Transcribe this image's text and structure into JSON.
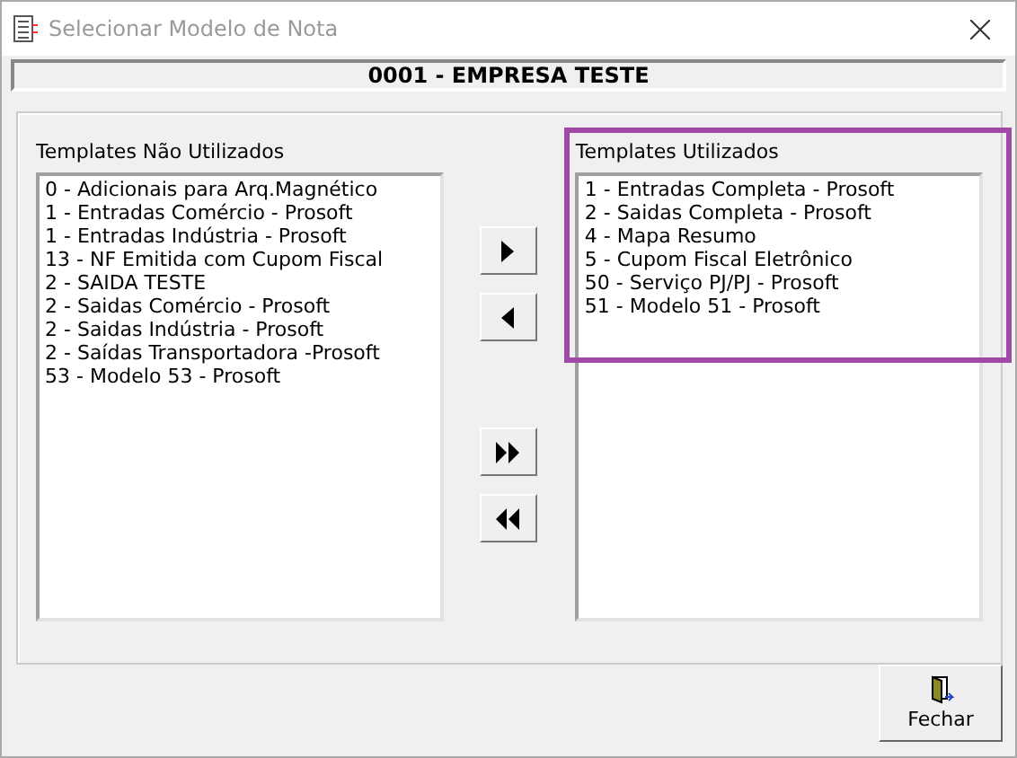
{
  "window": {
    "title": "Selecionar Modelo de Nota"
  },
  "company": "0001 - EMPRESA TESTE",
  "unused": {
    "label": "Templates Não Utilizados",
    "items": [
      {
        "text": "0 - Adicionais para Arq.Magnético"
      },
      {
        "text": "1 - Entradas Comércio - Prosoft"
      },
      {
        "text": "1 - Entradas Indústria - Prosoft"
      },
      {
        "text": "13 - NF Emitida com Cupom Fiscal"
      },
      {
        "text": "2 - SAIDA TESTE"
      },
      {
        "text": "2 - Saidas Comércio - Prosoft"
      },
      {
        "text": "2 - Saidas Indústria - Prosoft"
      },
      {
        "text": "2 - Saídas Transportadora -Prosoft"
      },
      {
        "text": "53 - Modelo 53 - Prosoft"
      }
    ]
  },
  "used": {
    "label": "Templates Utilizados",
    "highlighted": true,
    "items": [
      {
        "text": "1 - Entradas Completa - Prosoft"
      },
      {
        "text": "2 - Saidas Completa - Prosoft"
      },
      {
        "text": "4 - Mapa Resumo"
      },
      {
        "text": "5 - Cupom Fiscal Eletrônico"
      },
      {
        "text": "50 - Serviço PJ/PJ - Prosoft"
      },
      {
        "text": "51 - Modelo 51 - Prosoft"
      }
    ]
  },
  "move_buttons": [
    {
      "kind": "right"
    },
    {
      "kind": "left"
    },
    {
      "kind": "all_right"
    },
    {
      "kind": "all_left"
    }
  ],
  "close_button": {
    "label": "Fechar"
  }
}
